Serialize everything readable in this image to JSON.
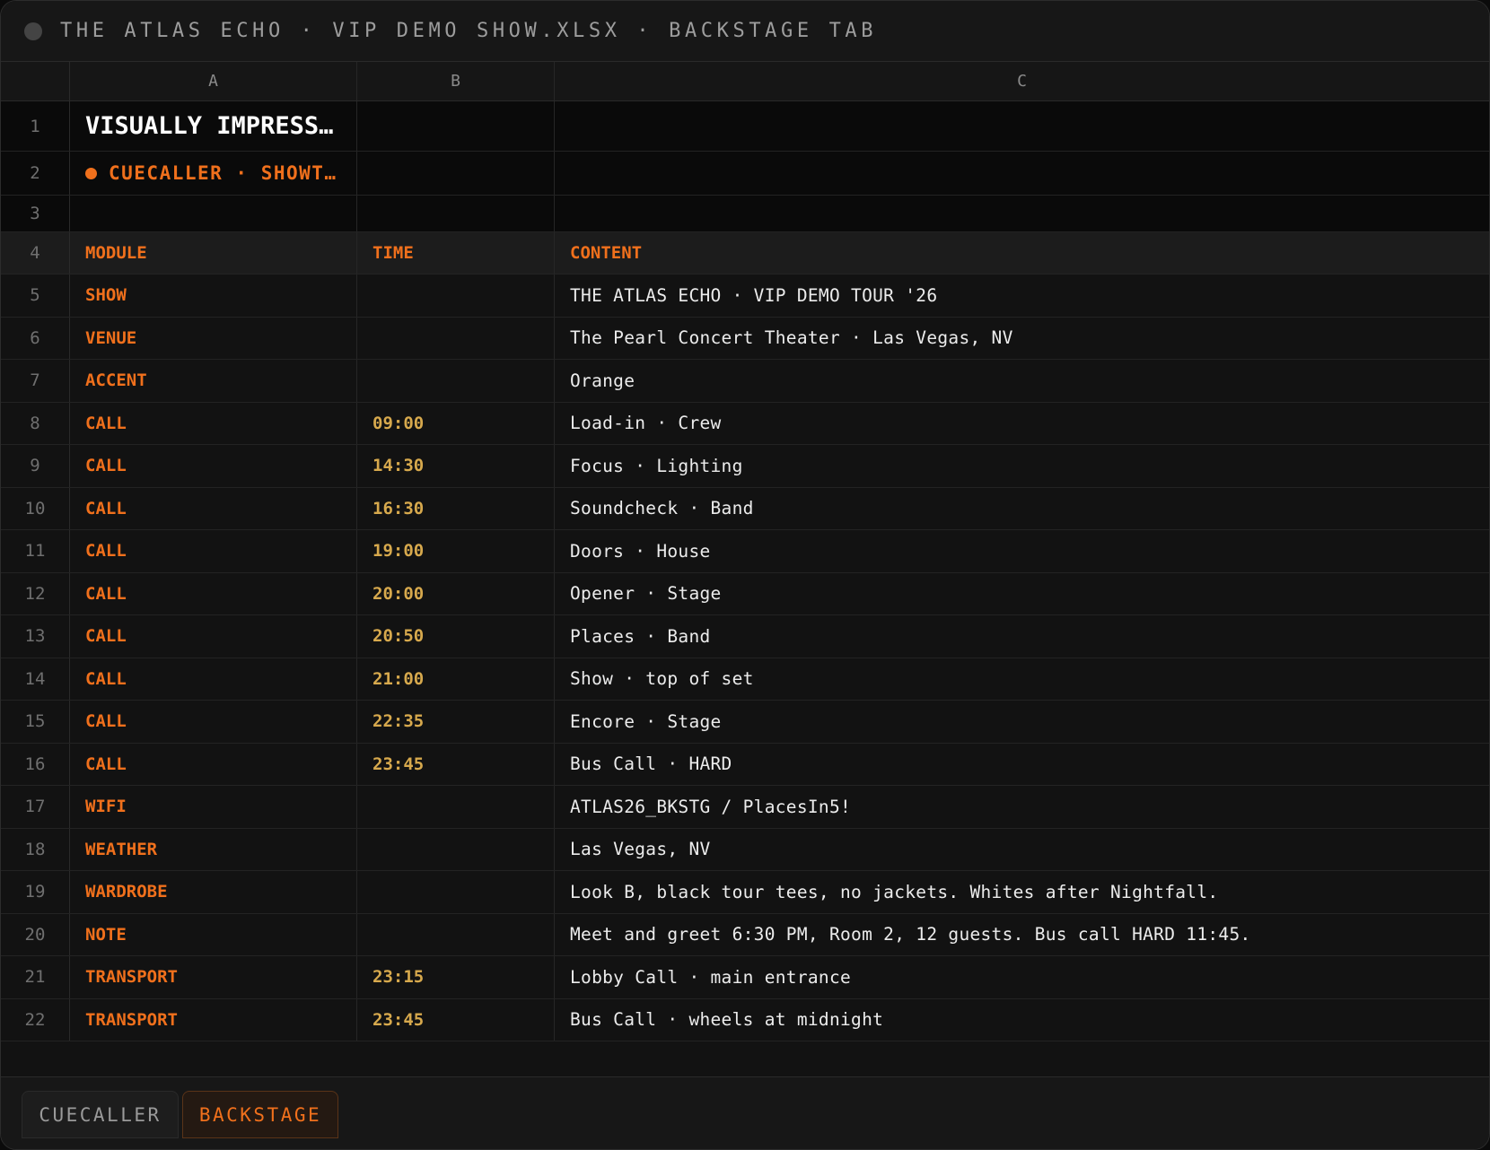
{
  "window": {
    "title": "THE ATLAS ECHO · VIP DEMO SHOW.XLSX · BACKSTAGE TAB"
  },
  "columns": [
    "A",
    "B",
    "C"
  ],
  "sheet": {
    "title_cell": "VISUALLY IMPRESS…",
    "subtitle_cell": "CUECALLER · SHOWT…",
    "headers": {
      "module": "MODULE",
      "time": "TIME",
      "content": "CONTENT"
    },
    "rows": [
      {
        "n": "5",
        "module": "SHOW",
        "time": "",
        "content": "THE ATLAS ECHO · VIP DEMO TOUR '26"
      },
      {
        "n": "6",
        "module": "VENUE",
        "time": "",
        "content": "The Pearl Concert Theater · Las Vegas, NV"
      },
      {
        "n": "7",
        "module": "ACCENT",
        "time": "",
        "content": "Orange"
      },
      {
        "n": "8",
        "module": "CALL",
        "time": "09:00",
        "content": "Load-in · Crew"
      },
      {
        "n": "9",
        "module": "CALL",
        "time": "14:30",
        "content": "Focus · Lighting"
      },
      {
        "n": "10",
        "module": "CALL",
        "time": "16:30",
        "content": "Soundcheck · Band"
      },
      {
        "n": "11",
        "module": "CALL",
        "time": "19:00",
        "content": "Doors · House"
      },
      {
        "n": "12",
        "module": "CALL",
        "time": "20:00",
        "content": "Opener · Stage"
      },
      {
        "n": "13",
        "module": "CALL",
        "time": "20:50",
        "content": "Places · Band"
      },
      {
        "n": "14",
        "module": "CALL",
        "time": "21:00",
        "content": "Show · top of set"
      },
      {
        "n": "15",
        "module": "CALL",
        "time": "22:35",
        "content": "Encore · Stage"
      },
      {
        "n": "16",
        "module": "CALL",
        "time": "23:45",
        "content": "Bus Call · HARD"
      },
      {
        "n": "17",
        "module": "WIFI",
        "time": "",
        "content": "ATLAS26_BKSTG / PlacesIn5!"
      },
      {
        "n": "18",
        "module": "WEATHER",
        "time": "",
        "content": "Las Vegas, NV"
      },
      {
        "n": "19",
        "module": "WARDROBE",
        "time": "",
        "content": "Look B, black tour tees, no jackets. Whites after Nightfall."
      },
      {
        "n": "20",
        "module": "NOTE",
        "time": "",
        "content": "Meet and greet 6:30 PM, Room 2, 12 guests. Bus call HARD 11:45."
      },
      {
        "n": "21",
        "module": "TRANSPORT",
        "time": "23:15",
        "content": "Lobby Call · main entrance"
      },
      {
        "n": "22",
        "module": "TRANSPORT",
        "time": "23:45",
        "content": "Bus Call · wheels at midnight"
      }
    ]
  },
  "tabs": [
    {
      "label": "CUECALLER",
      "active": false
    },
    {
      "label": "BACKSTAGE",
      "active": true
    }
  ],
  "colors": {
    "accent": "#f0701c",
    "time": "#d7a94d",
    "text": "#ececec",
    "background": "#121212"
  }
}
